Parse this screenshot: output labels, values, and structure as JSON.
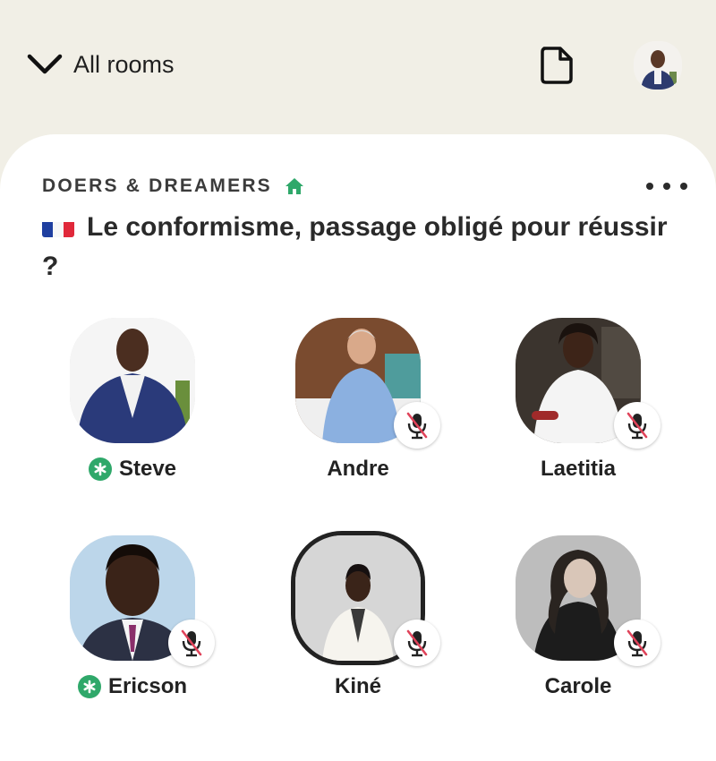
{
  "header": {
    "back_label": "All rooms",
    "back_icon": "chevron-down-icon",
    "document_icon": "document-icon",
    "profile_icon": "avatar"
  },
  "room": {
    "club_name": "DOERS & DREAMERS",
    "club_icon": "home-icon",
    "more_icon": "more-icon",
    "title_flag": "🇫🇷",
    "title": "Le conformisme, passage obligé pour réussir ?"
  },
  "speakers": [
    {
      "name": "Steve",
      "moderator": true,
      "muted": false
    },
    {
      "name": "Andre",
      "moderator": false,
      "muted": true
    },
    {
      "name": "Laetitia",
      "moderator": false,
      "muted": true
    },
    {
      "name": "Ericson",
      "moderator": true,
      "muted": true
    },
    {
      "name": "Kiné",
      "moderator": false,
      "muted": true
    },
    {
      "name": "Carole",
      "moderator": false,
      "muted": true
    }
  ],
  "colors": {
    "background": "#f1efe6",
    "card": "#ffffff",
    "moderator_badge": "#2fa86a",
    "home_icon": "#2fa86a",
    "mute_slash": "#e0435a"
  }
}
